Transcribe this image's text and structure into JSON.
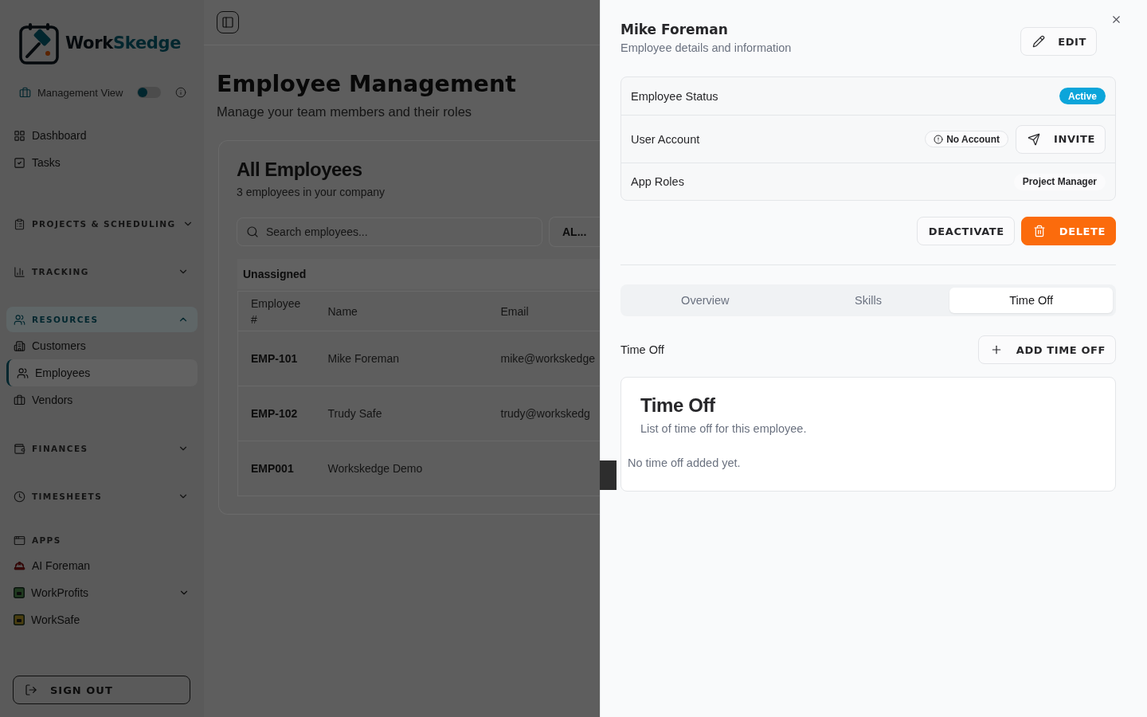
{
  "sidebar": {
    "logo": {
      "parts": [
        "Work",
        "Skedge"
      ]
    },
    "view_toggle": {
      "label": "Management View",
      "on": false
    },
    "nav": [
      {
        "kind": "link",
        "label": "Dashboard",
        "selected": false
      },
      {
        "kind": "link",
        "label": "Tasks",
        "selected": false
      },
      {
        "kind": "section",
        "label": "PROJECTS & SCHEDULING",
        "expanded": false
      },
      {
        "kind": "section",
        "label": "TRACKING",
        "expanded": false
      },
      {
        "kind": "section",
        "label": "RESOURCES",
        "expanded": true,
        "children": [
          {
            "kind": "link",
            "label": "Customers",
            "selected": false
          },
          {
            "kind": "link",
            "label": "Employees",
            "selected": true
          },
          {
            "kind": "link",
            "label": "Vendors",
            "selected": false
          }
        ]
      },
      {
        "kind": "section",
        "label": "FINANCES",
        "expanded": false
      },
      {
        "kind": "section",
        "label": "TIMESHEETS",
        "expanded": false
      },
      {
        "kind": "group",
        "label": "APPS",
        "children": [
          {
            "kind": "link",
            "label": "AI Foreman",
            "selected": false
          },
          {
            "kind": "menu",
            "label": "WorkProfits",
            "selected": false,
            "expanded": false
          },
          {
            "kind": "link",
            "label": "WorkSafe",
            "selected": false
          }
        ]
      }
    ],
    "sign_out": "SIGN OUT"
  },
  "main": {
    "page": {
      "title": "Employee Management",
      "subtitle": "Manage your team members and their roles"
    },
    "employees": {
      "title": "All Employees",
      "subtitle": "3 employees in your company",
      "search": {
        "placeholder": "Search employees..."
      },
      "filter": "AL...",
      "group": "Unassigned",
      "columns": [
        "Employee #",
        "Name",
        "Email"
      ],
      "rows": [
        {
          "employee_no": "EMP-101",
          "name": "Mike Foreman",
          "email": "mike@workskedge"
        },
        {
          "employee_no": "EMP-102",
          "name": "Trudy Safe",
          "email": "trudy@workskedg"
        },
        {
          "employee_no": "EMP001",
          "name": "Workskedge Demo"
        }
      ]
    }
  },
  "detail_panel": {
    "title": "Mike Foreman",
    "subtitle": "Employee details and information",
    "edit": "EDIT",
    "fields": [
      {
        "kind": "status",
        "label": "Employee Status",
        "value": "Active"
      },
      {
        "kind": "account",
        "label": "User Account",
        "value": "No Account",
        "action": "INVITE"
      },
      {
        "kind": "roles",
        "label": "App Roles",
        "roles": [
          "Project Manager"
        ]
      }
    ],
    "actions": [
      {
        "kind": "outline",
        "label": "DEACTIVATE"
      },
      {
        "kind": "danger",
        "label": "DELETE"
      }
    ],
    "tabs": [
      {
        "label": "Overview",
        "selected": false
      },
      {
        "label": "Skills",
        "selected": false
      },
      {
        "label": "Time Off",
        "selected": true
      }
    ],
    "section": {
      "label": "Time Off",
      "action": "ADD TIME OFF"
    },
    "time_off_card": {
      "title": "Time Off",
      "subtitle": "List of time off for this employee.",
      "empty": "No time off added yet."
    }
  }
}
